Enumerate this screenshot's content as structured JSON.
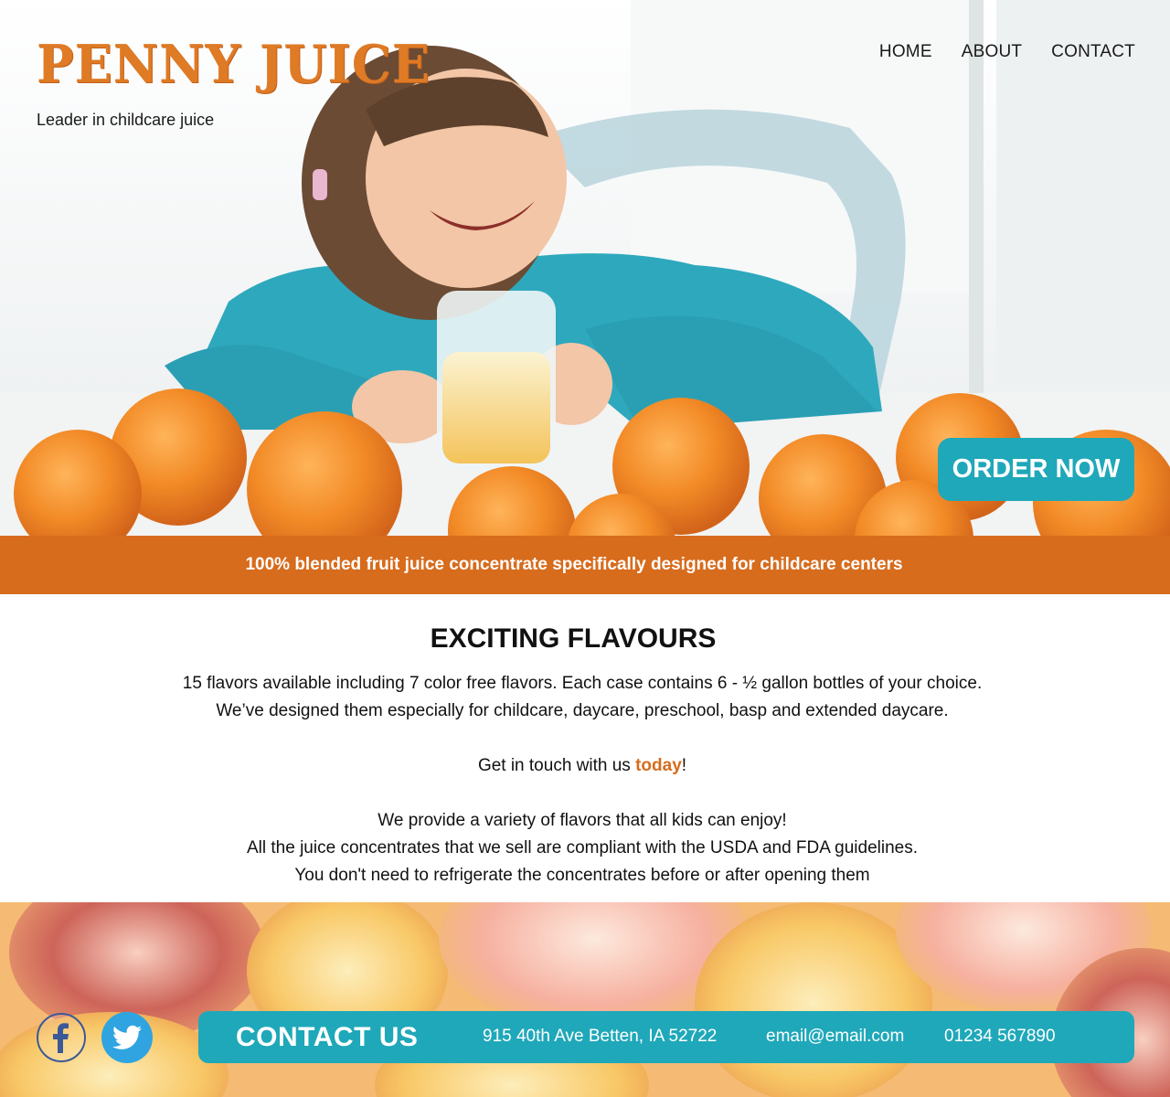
{
  "brand": {
    "logo": "PENNY JUICE",
    "tagline": "Leader in childcare juice",
    "accent_color": "#d76c1d",
    "teal_color": "#1fa8b9"
  },
  "nav": {
    "items": [
      "HOME",
      "ABOUT",
      "CONTACT"
    ]
  },
  "hero": {
    "cta_label": "ORDER NOW"
  },
  "banner": {
    "text": "100% blended fruit juice concentrate specifically designed for childcare centers"
  },
  "main": {
    "title": "EXCITING FLAVOURS",
    "paragraph1": [
      "15 flavors available including 7 color free flavors. Each case contains 6 - ½ gallon bottles of your choice.",
      "We’ve designed them especially for childcare, daycare, preschool, basp and extended daycare."
    ],
    "cta_prefix": "Get in touch with us ",
    "cta_link": "today",
    "cta_suffix": "!",
    "paragraph3": [
      "We provide a variety of flavors that all kids can enjoy!",
      "All the juice concentrates that we sell are compliant with the USDA and FDA guidelines.",
      "You don't need to refrigerate the concentrates before or after opening them"
    ]
  },
  "footer": {
    "social": [
      "facebook-icon",
      "twitter-icon"
    ],
    "contact_title": "CONTACT US",
    "address": "915 40th Ave Betten, IA 52722",
    "email": "email@email.com",
    "phone": "01234 567890"
  }
}
